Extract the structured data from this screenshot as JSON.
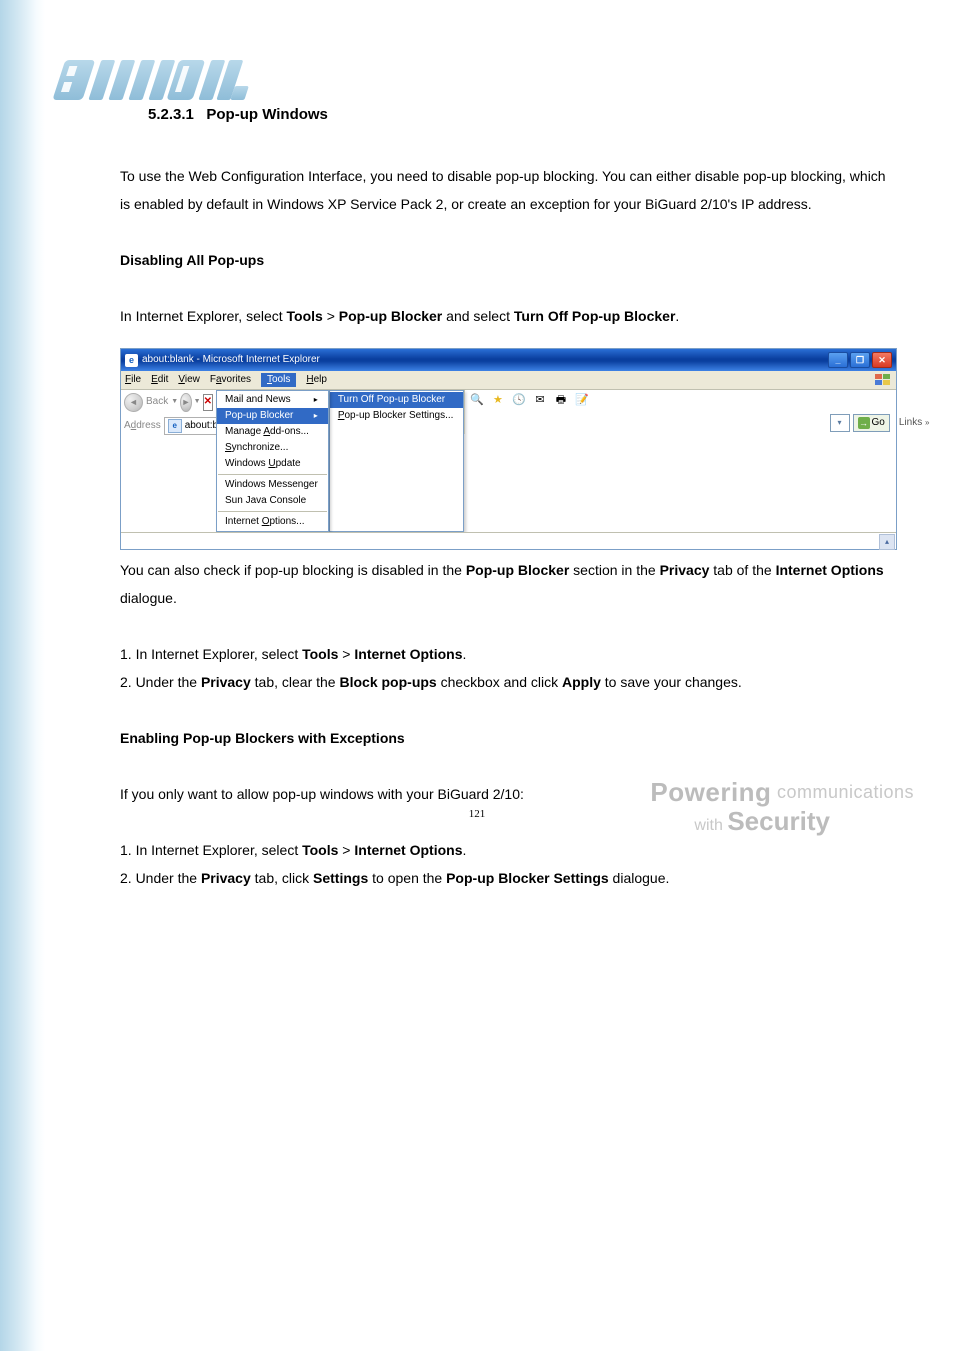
{
  "header": {
    "section_number": "5.2.3.1",
    "section_title": "Pop-up Windows"
  },
  "body": {
    "intro_p1": "To use the Web Configuration Interface, you need to disable pop-up blocking. You can either disable pop-up blocking, which is enabled by default in Windows XP Service Pack 2, or create an exception for your BiGuard 2/10's IP address.",
    "heading_disable": "Disabling All Pop-ups",
    "disable_p_prefix": "In Internet Explorer, select ",
    "disable_p_tools": "Tools",
    "disable_p_gt": " > ",
    "disable_p_popup": "Pop-up Blocker",
    "disable_p_andselect": " and select ",
    "disable_p_turnoff": "Turn Off Pop-up Blocker",
    "disable_p_period": ".",
    "check_p_prefix": "You can also check if pop-up blocking is disabled in the ",
    "check_p_popup": "Pop-up Blocker",
    "check_p_sectionin": " section in the ",
    "check_p_privacy": "Privacy",
    "check_p_tabof": " tab of the ",
    "check_p_io": "Internet Options",
    "check_p_dialogue": " dialogue.",
    "step1_prefix": "1. In Internet Explorer, select ",
    "step1_tools": "Tools",
    "step1_gt": " > ",
    "step1_io": "Internet Options",
    "step1_period": ".",
    "step2_prefix": "2. Under the ",
    "step2_privacy": "Privacy",
    "step2_tabclear": " tab, clear the ",
    "step2_block": "Block pop-ups",
    "step2_cbclick": " checkbox and click ",
    "step2_apply": "Apply",
    "step2_tosave": " to save your changes.",
    "heading_enable": "Enabling Pop-up Blockers with Exceptions",
    "enable_p": "If you only want to allow pop-up windows with your BiGuard 2/10:",
    "estep1_prefix": "1. In Internet Explorer, select ",
    "estep1_tools": "Tools",
    "estep1_gt": " > ",
    "estep1_io": "Internet Options",
    "estep1_period": ".",
    "estep2_prefix": "2. Under the ",
    "estep2_privacy": "Privacy",
    "estep2_tabclick": " tab, click ",
    "estep2_settings": "Settings",
    "estep2_toopen": " to open the ",
    "estep2_pbs": "Pop-up Blocker Settings",
    "estep2_dialogue": " dialogue."
  },
  "ie": {
    "title": "about:blank - Microsoft Internet Explorer",
    "menu_file": "File",
    "menu_edit": "Edit",
    "menu_view": "View",
    "menu_favorites": "Favorites",
    "menu_tools": "Tools",
    "menu_help": "Help",
    "back_label": "Back",
    "address_label": "Address",
    "address_value": "about:blank",
    "go_label": "Go",
    "links_label": "Links",
    "dropdown": {
      "mail_news": "Mail and News",
      "popup_blocker": "Pop-up Blocker",
      "manage_addons": "Manage Add-ons...",
      "synchronize": "Synchronize...",
      "windows_update": "Windows Update",
      "windows_messenger": "Windows Messenger",
      "sun_java": "Sun Java Console",
      "internet_options": "Internet Options..."
    },
    "submenu": {
      "turn_off": "Turn Off Pop-up Blocker",
      "settings": "Pop-up Blocker Settings..."
    }
  },
  "footer": {
    "page_number": "121",
    "brand_powering": "Powering",
    "brand_comm": " communications",
    "brand_with": "with ",
    "brand_security": "Security"
  }
}
